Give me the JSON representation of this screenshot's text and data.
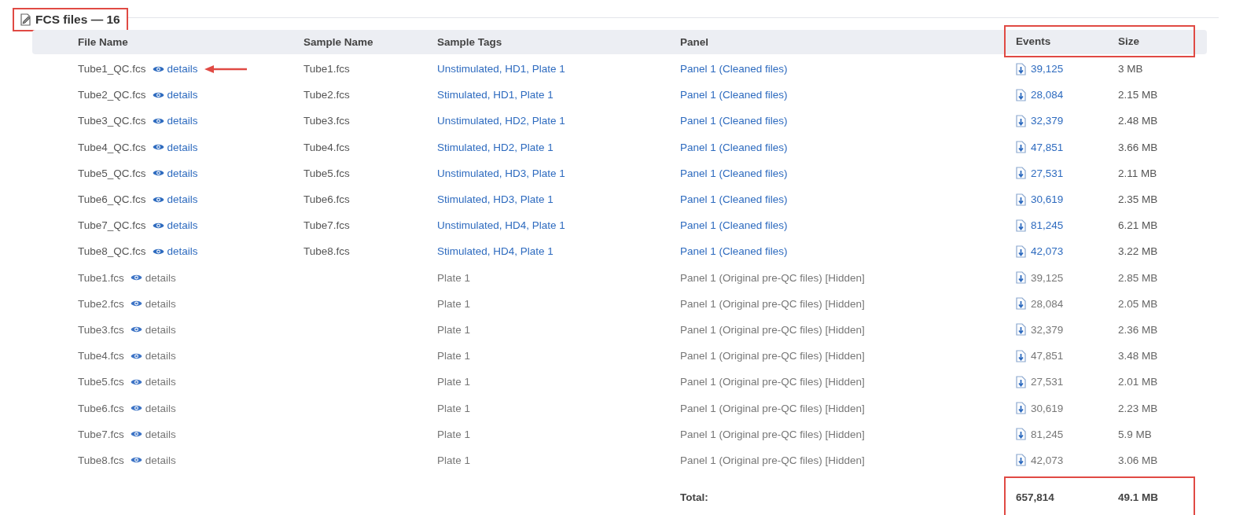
{
  "section": {
    "title": "FCS files — 16",
    "highlighted": true
  },
  "table": {
    "columns": [
      "File Name",
      "Sample Name",
      "Sample Tags",
      "Panel",
      "Events",
      "Size"
    ],
    "header_highlighted": true,
    "rows": [
      {
        "file": "Tube1_QC.fcs",
        "details": "details",
        "sample": "Tube1.fcs",
        "tags": "Unstimulated, HD1, Plate 1",
        "panel": "Panel 1 (Cleaned files)",
        "events": "39,125",
        "size": "3 MB",
        "hidden": false,
        "pointed": true
      },
      {
        "file": "Tube2_QC.fcs",
        "details": "details",
        "sample": "Tube2.fcs",
        "tags": "Stimulated, HD1, Plate 1",
        "panel": "Panel 1 (Cleaned files)",
        "events": "28,084",
        "size": "2.15 MB",
        "hidden": false,
        "pointed": false
      },
      {
        "file": "Tube3_QC.fcs",
        "details": "details",
        "sample": "Tube3.fcs",
        "tags": "Unstimulated, HD2, Plate 1",
        "panel": "Panel 1 (Cleaned files)",
        "events": "32,379",
        "size": "2.48 MB",
        "hidden": false,
        "pointed": false
      },
      {
        "file": "Tube4_QC.fcs",
        "details": "details",
        "sample": "Tube4.fcs",
        "tags": "Stimulated, HD2, Plate 1",
        "panel": "Panel 1 (Cleaned files)",
        "events": "47,851",
        "size": "3.66 MB",
        "hidden": false,
        "pointed": false
      },
      {
        "file": "Tube5_QC.fcs",
        "details": "details",
        "sample": "Tube5.fcs",
        "tags": "Unstimulated, HD3, Plate 1",
        "panel": "Panel 1 (Cleaned files)",
        "events": "27,531",
        "size": "2.11 MB",
        "hidden": false,
        "pointed": false
      },
      {
        "file": "Tube6_QC.fcs",
        "details": "details",
        "sample": "Tube6.fcs",
        "tags": "Stimulated, HD3, Plate 1",
        "panel": "Panel 1 (Cleaned files)",
        "events": "30,619",
        "size": "2.35 MB",
        "hidden": false,
        "pointed": false
      },
      {
        "file": "Tube7_QC.fcs",
        "details": "details",
        "sample": "Tube7.fcs",
        "tags": "Unstimulated, HD4, Plate 1",
        "panel": "Panel 1 (Cleaned files)",
        "events": "81,245",
        "size": "6.21 MB",
        "hidden": false,
        "pointed": false
      },
      {
        "file": "Tube8_QC.fcs",
        "details": "details",
        "sample": "Tube8.fcs",
        "tags": "Stimulated, HD4, Plate 1",
        "panel": "Panel 1 (Cleaned files)",
        "events": "42,073",
        "size": "3.22 MB",
        "hidden": false,
        "pointed": false
      },
      {
        "file": "Tube1.fcs",
        "details": "details",
        "tags": "Plate 1",
        "panel": "Panel 1 (Original pre-QC files) [Hidden]",
        "events": "39,125",
        "size": "2.85 MB",
        "hidden": true,
        "pointed": false
      },
      {
        "file": "Tube2.fcs",
        "details": "details",
        "tags": "Plate 1",
        "panel": "Panel 1 (Original pre-QC files) [Hidden]",
        "events": "28,084",
        "size": "2.05 MB",
        "hidden": true,
        "pointed": false
      },
      {
        "file": "Tube3.fcs",
        "details": "details",
        "tags": "Plate 1",
        "panel": "Panel 1 (Original pre-QC files) [Hidden]",
        "events": "32,379",
        "size": "2.36 MB",
        "hidden": true,
        "pointed": false
      },
      {
        "file": "Tube4.fcs",
        "details": "details",
        "tags": "Plate 1",
        "panel": "Panel 1 (Original pre-QC files) [Hidden]",
        "events": "47,851",
        "size": "3.48 MB",
        "hidden": true,
        "pointed": false
      },
      {
        "file": "Tube5.fcs",
        "details": "details",
        "tags": "Plate 1",
        "panel": "Panel 1 (Original pre-QC files) [Hidden]",
        "events": "27,531",
        "size": "2.01 MB",
        "hidden": true,
        "pointed": false
      },
      {
        "file": "Tube6.fcs",
        "details": "details",
        "tags": "Plate 1",
        "panel": "Panel 1 (Original pre-QC files) [Hidden]",
        "events": "30,619",
        "size": "2.23 MB",
        "hidden": true,
        "pointed": false
      },
      {
        "file": "Tube7.fcs",
        "details": "details",
        "tags": "Plate 1",
        "panel": "Panel 1 (Original pre-QC files) [Hidden]",
        "events": "81,245",
        "size": "5.9 MB",
        "hidden": true,
        "pointed": false
      },
      {
        "file": "Tube8.fcs",
        "details": "details",
        "tags": "Plate 1",
        "panel": "Panel 1 (Original pre-QC files) [Hidden]",
        "events": "42,073",
        "size": "3.06 MB",
        "hidden": true,
        "pointed": false
      }
    ],
    "total": {
      "label": "Total:",
      "events": "657,814",
      "size": "49.1 MB",
      "highlighted": true
    }
  }
}
